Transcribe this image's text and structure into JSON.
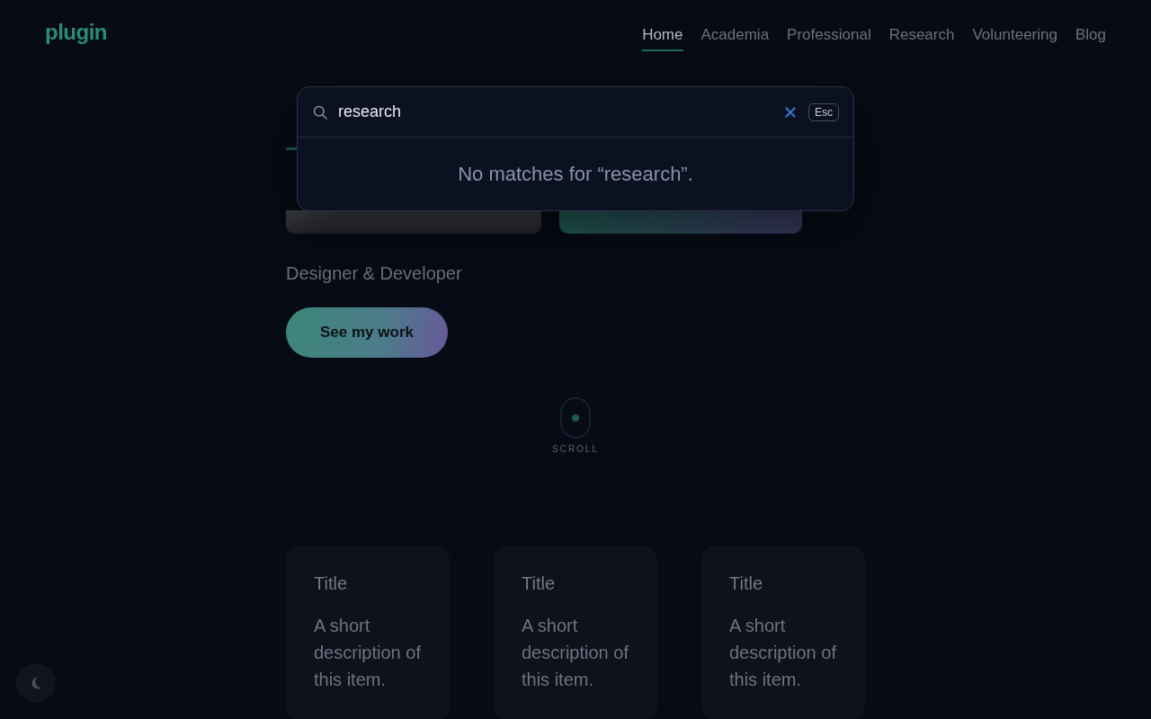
{
  "logo": "plugin",
  "nav": [
    {
      "label": "Home",
      "selected": true
    },
    {
      "label": "Academia",
      "selected": false
    },
    {
      "label": "Professional",
      "selected": false
    },
    {
      "label": "Research",
      "selected": false
    },
    {
      "label": "Volunteering",
      "selected": false
    },
    {
      "label": "Blog",
      "selected": false
    }
  ],
  "hero": {
    "subtitle": "Designer & Developer",
    "cta": "See my work",
    "scroll_hint": "SCROLL"
  },
  "cards": [
    {
      "title": "Title",
      "description": "A short description of this item."
    },
    {
      "title": "Title",
      "description": "A short description of this item."
    },
    {
      "title": "Title",
      "description": "A short description of this item."
    }
  ],
  "search": {
    "value": "research",
    "key_hint": "Esc",
    "empty_message": "No matches for “research”."
  }
}
